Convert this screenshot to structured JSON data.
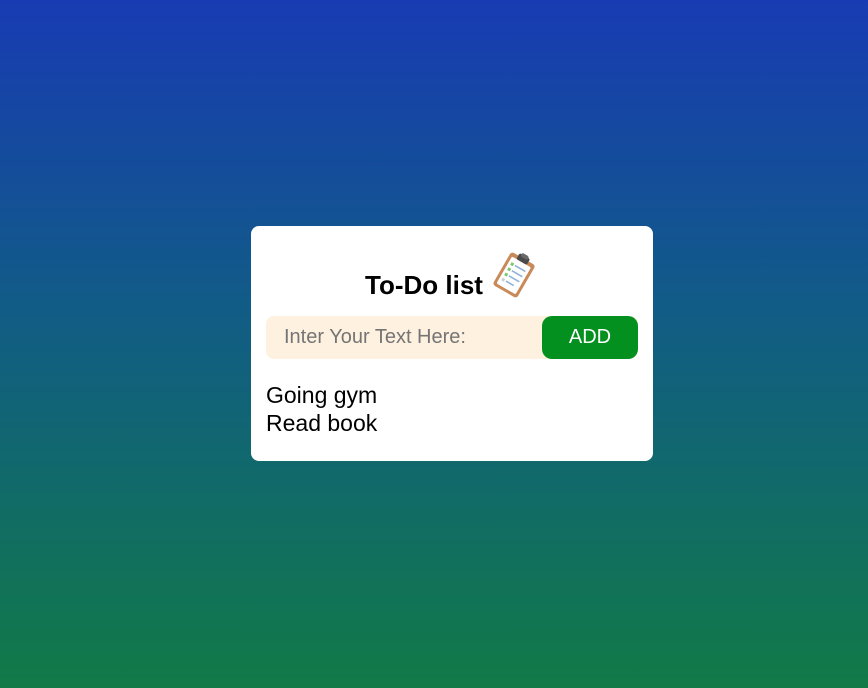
{
  "app": {
    "title": "To-Do list",
    "title_icon": "clipboard-icon"
  },
  "input": {
    "value": "",
    "placeholder": "Inter Your Text Here:"
  },
  "add_button": {
    "label": "ADD",
    "color": "#03901f"
  },
  "tasks": [
    {
      "label": "Going gym"
    },
    {
      "label": "Read book"
    }
  ],
  "colors": {
    "background_top": "#183bb3",
    "background_bottom": "#117a47",
    "card": "#ffffff",
    "input_background": "#fef1e0"
  }
}
